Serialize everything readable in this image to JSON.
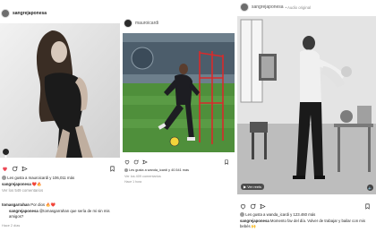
{
  "post1": {
    "username": "sangrejaponesa",
    "likes_text": "Les gusta a mauroicardi y 106,011 más",
    "caption_user": "sangrejaponesa",
    "caption_emoji": "❤️🔥",
    "comments_link": "Ver los 549 comentarios",
    "comment1_user": "tomasgarrahan",
    "comment1_text": "Por dios 🔥❤️",
    "reply_user": "sangrejaponesa",
    "reply_text": "@tomasgarrahan que sería de mi sin mis amigos?",
    "time": "Hace 2 días"
  },
  "post2": {
    "username": "mauroicardi",
    "likes_text": "Les gusta a wanda_icardi y 40.541 más",
    "comments_link": "Ver los 409 comentarios",
    "time": "Hace 1 hora"
  },
  "post3": {
    "username": "sangrejaponesa",
    "subtitle": "• Audio original",
    "reels_label": "Ver reels",
    "likes_text": "Les gusta a wanda_icardi y 123.460 más",
    "caption_user": "sangrejaponesa",
    "caption_text": "Momento fav del día. Volver de trabajar y bailar con mis bebés 🙌"
  },
  "colors": {
    "text": "#262626",
    "muted": "#8e8e8e",
    "like_red": "#ed4956",
    "pitch_green": "#4f8f3b"
  }
}
